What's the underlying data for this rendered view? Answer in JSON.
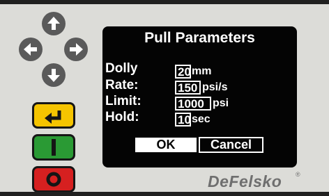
{
  "dialog": {
    "title": "Pull Parameters",
    "rows": [
      {
        "label": "Dolly",
        "value": "20",
        "unit": "mm"
      },
      {
        "label": "Rate:",
        "value": "150",
        "unit": "psi/s"
      },
      {
        "label": "Limit:",
        "value": "1000",
        "unit": "psi"
      },
      {
        "label": "Hold:",
        "value": "10",
        "unit": "sec"
      }
    ],
    "ok_label": "OK",
    "cancel_label": "Cancel"
  },
  "keypad": {
    "dpad": [
      "up-arrow-icon",
      "left-arrow-icon",
      "right-arrow-icon",
      "down-arrow-icon"
    ],
    "enter_key_color": "#f5c400",
    "green_key_color": "#2a9a34",
    "red_key_color": "#d62020"
  },
  "brand": {
    "name": "DeFelsko",
    "registered": "®"
  }
}
